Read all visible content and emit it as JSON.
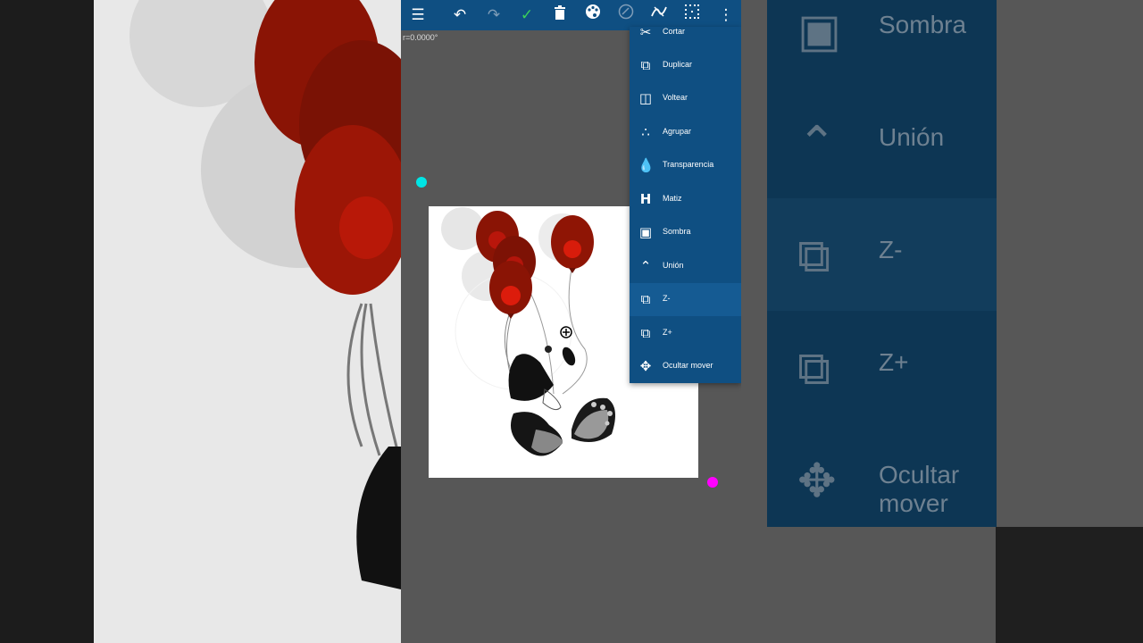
{
  "toolbar": {
    "icons": [
      "menu-icon",
      "undo-icon",
      "redo-icon",
      "check-icon",
      "trash-icon",
      "palette-icon",
      "brush-icon",
      "curve-icon",
      "grid-select-icon",
      "more-vert-icon"
    ]
  },
  "rotation_label": "r=0.0000°",
  "menu": {
    "items": [
      {
        "label": "Cortar",
        "icon": "scissors-icon"
      },
      {
        "label": "Duplicar",
        "icon": "duplicate-icon"
      },
      {
        "label": "Voltear",
        "icon": "flip-icon"
      },
      {
        "label": "Agrupar",
        "icon": "group-icon"
      },
      {
        "label": "Transparencia",
        "icon": "drop-icon"
      },
      {
        "label": "Matiz",
        "icon": "hue-icon"
      },
      {
        "label": "Sombra",
        "icon": "shadow-icon"
      },
      {
        "label": "Unión",
        "icon": "join-icon"
      },
      {
        "label": "Z-",
        "icon": "z-minus-icon"
      },
      {
        "label": "Z+",
        "icon": "z-plus-icon"
      },
      {
        "label": "Ocultar mover",
        "icon": "hide-move-icon"
      }
    ],
    "selected": "Z-"
  },
  "background_menu": {
    "items": [
      {
        "label": "Sombra"
      },
      {
        "label": "Unión"
      },
      {
        "label": "Z-"
      },
      {
        "label": "Z+"
      },
      {
        "label": "Ocultar mover"
      }
    ]
  },
  "colors": {
    "toolbar": "#0f4f82",
    "menu": "#0f4f82",
    "handle_top_left": "#00e5e5",
    "handle_bottom_right": "#ff00ff",
    "balloon": "#b01010"
  }
}
